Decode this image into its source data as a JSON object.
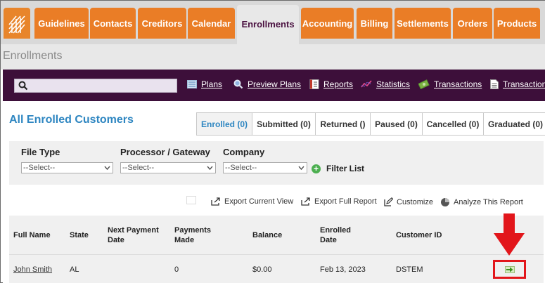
{
  "nav": {
    "tabs": [
      {
        "label": "Guidelines"
      },
      {
        "label": "Contacts"
      },
      {
        "label": "Creditors"
      },
      {
        "label": "Calendar"
      },
      {
        "label": "Enrollments",
        "active": true
      },
      {
        "label": "Accounting"
      },
      {
        "label": "Billing"
      },
      {
        "label": "Settlements"
      },
      {
        "label": "Orders"
      },
      {
        "label": "Products"
      }
    ],
    "brand_color": "#ea7d26",
    "active_text_color": "#4a1140"
  },
  "page": {
    "title": "Enrollments"
  },
  "toolbar": {
    "search": {
      "value": "",
      "placeholder": ""
    },
    "links": [
      {
        "label": "Plans",
        "icon": "plans-icon"
      },
      {
        "label": "Preview Plans",
        "icon": "magnifier-icon"
      },
      {
        "label": "Reports",
        "icon": "reports-icon"
      },
      {
        "label": "Statistics",
        "icon": "statistics-icon"
      },
      {
        "label": "Transactions",
        "icon": "money-icon"
      },
      {
        "label": "Transaction",
        "icon": "document-icon"
      }
    ],
    "color": "#3d0f3a"
  },
  "main": {
    "section_title": "All Enrolled Customers",
    "status_tabs": [
      {
        "label": "Enrolled (0)",
        "active": true
      },
      {
        "label": "Submitted (0)"
      },
      {
        "label": "Returned ()"
      },
      {
        "label": "Paused (0)"
      },
      {
        "label": "Cancelled (0)"
      },
      {
        "label": "Graduated (0)"
      }
    ]
  },
  "filters": {
    "file_type": {
      "label": "File Type",
      "selected": "--Select--"
    },
    "processor": {
      "label": "Processor / Gateway",
      "selected": "--Select--"
    },
    "company": {
      "label": "Company",
      "selected": "--Select--"
    },
    "filter_button": "Filter List"
  },
  "actions": {
    "export_current": "Export Current View",
    "export_full": "Export Full Report",
    "customize": "Customize",
    "analyze": "Analyze This Report"
  },
  "table": {
    "headers": {
      "full_name": "Full Name",
      "state": "State",
      "next_payment_1": "Next Payment",
      "next_payment_2": "Date",
      "payments_1": "Payments",
      "payments_2": "Made",
      "balance": "Balance",
      "enrolled_1": "Enrolled",
      "enrolled_2": "Date",
      "customer_id": "Customer ID"
    },
    "rows": [
      {
        "full_name": "John Smith",
        "state": "AL",
        "next_payment_date": "",
        "payments_made": "0",
        "balance": "$0.00",
        "enrolled_date": "Feb 13, 2023",
        "customer_id": "DSTEM"
      }
    ]
  },
  "annotation": {
    "arrow_color": "#e2161b"
  }
}
